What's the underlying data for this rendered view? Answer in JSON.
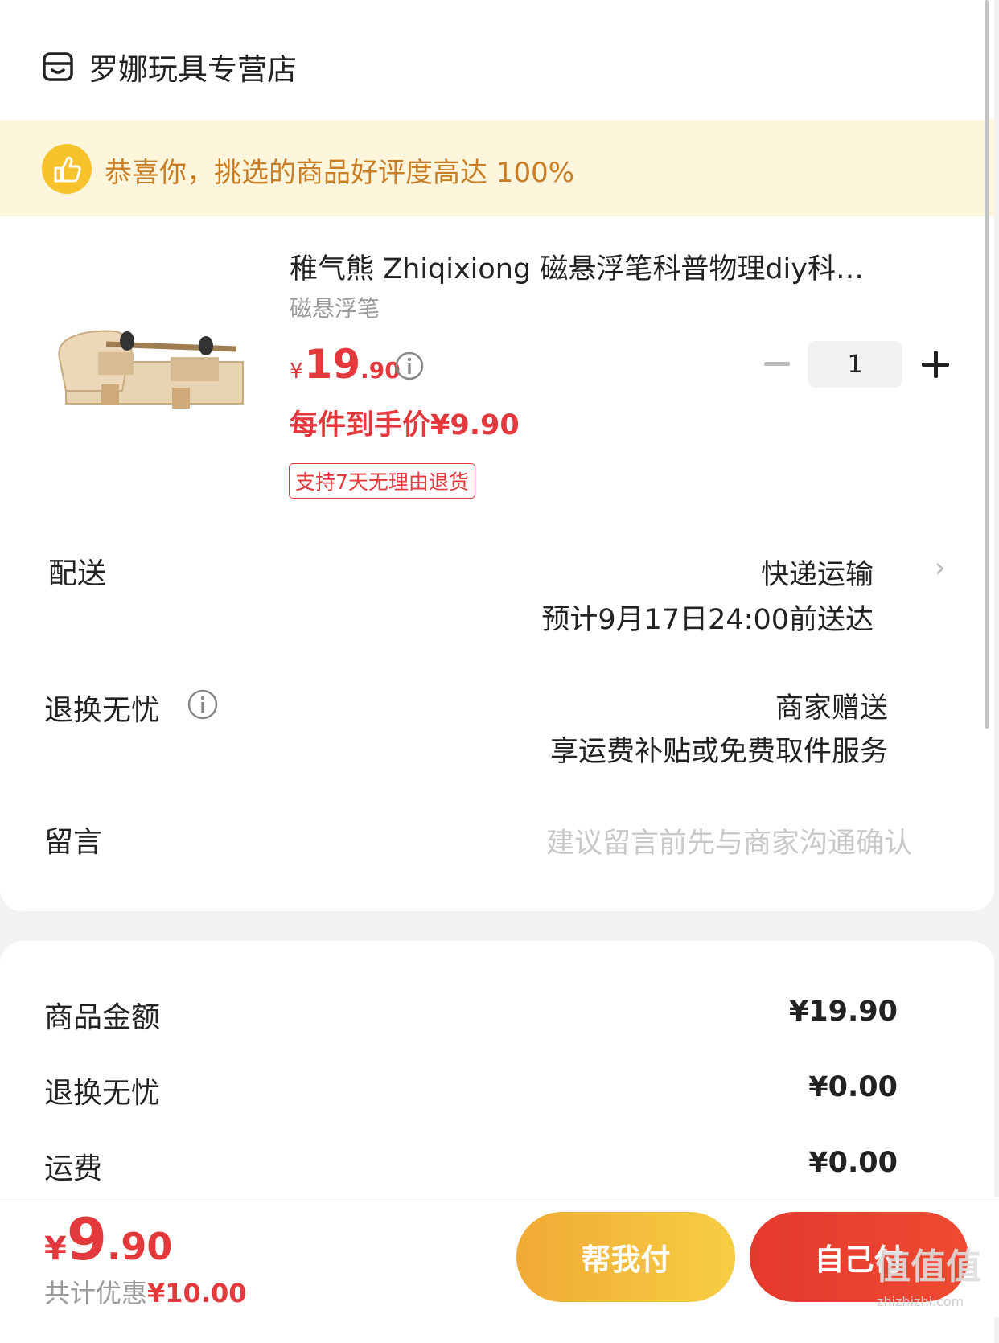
{
  "store": {
    "name": "罗娜玩具专营店",
    "icon": "store-icon"
  },
  "banner": {
    "text": "恭喜你，挑选的商品好评度高达 100%",
    "icon": "thumbs-up-icon"
  },
  "product": {
    "title": "稚气熊 Zhiqixiong  磁悬浮笔科普物理diy科…",
    "spec": "磁悬浮笔",
    "price_currency": "¥",
    "price_int": "19",
    "price_dec": ".90",
    "unit_price": "每件到手价¥9.90",
    "tag": "支持7天无理由退货",
    "quantity": "1"
  },
  "delivery": {
    "label": "配送",
    "method": "快递运输",
    "eta": "预计9月17日24:00前送达"
  },
  "returns": {
    "label": "退换无忧",
    "value": "商家赠送",
    "desc": "享运费补贴或免费取件服务"
  },
  "message": {
    "label": "留言",
    "placeholder": "建议留言前先与商家沟通确认"
  },
  "summary": [
    {
      "label": "商品金额",
      "value": "¥19.90"
    },
    {
      "label": "退换无忧",
      "value": "¥0.00"
    },
    {
      "label": "运费",
      "value": "¥0.00"
    }
  ],
  "footer": {
    "total_currency": "¥",
    "total_int": "9",
    "total_dec": ".90",
    "discount_label": "共计优惠",
    "discount_amount": "¥10.00",
    "help_pay": "帮我付",
    "self_pay": "自己付"
  },
  "watermark": {
    "text": "值值值",
    "sub": "zhizhizhi.com"
  },
  "colors": {
    "accent": "#e4393c",
    "banner_bg": "#fdf6dd",
    "banner_text": "#c97e25",
    "help_btn": "#f3bd3d"
  }
}
